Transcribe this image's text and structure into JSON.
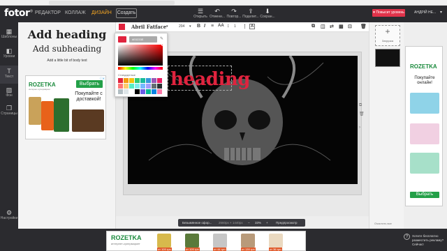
{
  "header": {
    "logo": "fotor",
    "logo_mark": "®",
    "nav": [
      "РЕДАКТОР",
      "КОЛЛАЖ",
      "ДИЗАЙН"
    ],
    "create_label": "Создать",
    "tools": [
      {
        "icon": "menu-icon",
        "label": "Открыть"
      },
      {
        "icon": "undo-icon",
        "label": "Отмени..."
      },
      {
        "icon": "redo-icon",
        "label": "Повтор..."
      },
      {
        "icon": "share-icon",
        "label": "Поделит..."
      },
      {
        "icon": "save-icon",
        "label": "Сохран..."
      }
    ],
    "premium_label": "Повысит уровень",
    "user_label": "АНДРІЙ НЕ..."
  },
  "left_sidebar": [
    {
      "icon": "template-icon",
      "label": "Шаблоны"
    },
    {
      "icon": "layout-icon",
      "label": "Уровни"
    },
    {
      "icon": "text-icon",
      "label": "Текст"
    },
    {
      "icon": "background-icon",
      "label": "Фон"
    },
    {
      "icon": "pages-icon",
      "label": "Страницы"
    },
    {
      "icon": "settings-icon",
      "label": "Настройки"
    }
  ],
  "text_panel": {
    "heading": "Add heading",
    "subheading": "Add subheading",
    "body": "Add a little bit of body text"
  },
  "ad_left": {
    "brand": "ROZETKA",
    "tagline": "интернет-супермаркет",
    "button": "Выбрать",
    "text": "Покупайте с доставкой!"
  },
  "text_toolbar": {
    "font": "Abril Fatface",
    "size": "204",
    "spacing": "1",
    "color": "#e0233e"
  },
  "canvas": {
    "text": "heading"
  },
  "color_picker": {
    "hex": "#E0233E",
    "label": "Стандартные",
    "swatches": [
      "#e0233e",
      "#f39c12",
      "#f1c40f",
      "#2ecc71",
      "#1abc9c",
      "#3498db",
      "#9b59b6",
      "#e91e63",
      "#ff7675",
      "#fdcb6e",
      "#55efc4",
      "#81ecec",
      "#74b9ff",
      "#a29bfe",
      "#636e72",
      "#2d3436",
      "#b2bec3",
      "#dfe6e9",
      "#ffffff",
      "#000000",
      "#6c5ce7",
      "#00b894",
      "#0984e3",
      "#fd79a8"
    ]
  },
  "bottom_bar": {
    "doc_name": "Безымянное офор...",
    "dimensions": "2560px × 1440px",
    "zoom": "33%",
    "preview": "Предпросмотр"
  },
  "pages_panel": {
    "upload_label": "Загрузка",
    "footer": "Очистить все"
  },
  "ad_right": {
    "brand": "ROZETKA",
    "text": "Покупайте онлайн!",
    "button": "Выбрать"
  },
  "ad_bottom": {
    "brand": "ROZETKA",
    "tagline": "интернет-супермаркет",
    "prices": [
      "от 109 грн",
      "от 109 грн",
      "от 44 грн",
      "от 139 грн",
      "от 36 грн"
    ]
  },
  "help": {
    "line1": "Хотите бесплатно",
    "line2": "разместить рекламу?",
    "line3": "Сейчас!"
  }
}
